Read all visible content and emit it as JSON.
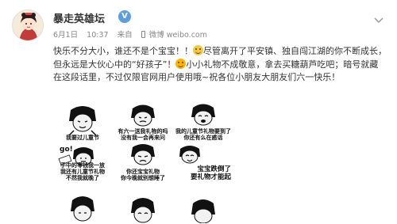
{
  "user": {
    "name": "暴走英雄坛",
    "verified_badge": "V"
  },
  "meta": {
    "date": "6月1日",
    "time": "10:37",
    "source_prefix": "来自",
    "source": "微博 weibo.com"
  },
  "post": {
    "segments": [
      "快乐不分大小，谁还不是个宝宝！！",
      "尽管离开了平安镇、独自闯江湖的你不断成长，但永远是大伙心中的“好孩子”！",
      "小小礼物不成敬意，拿去买糖葫芦吃吧；暗号就藏在这段话里，不过仅限官网用户使用哦~祝各位小朋友大朋友们六一快乐！"
    ]
  },
  "images": [
    {
      "caption": "我要过儿童节"
    },
    {
      "caption": "有六一送我礼物的吗\n没有我一会再来问"
    },
    {
      "caption": "我的儿童节礼物要到了\n你还有么在惑话"
    },
    {
      "caption": "手中的零钱我一放\n我还有儿童节礼物\n不然我就晚了",
      "badge": "go!"
    },
    {
      "caption": "你还宝宝礼物\n你今晚就别想睡了"
    },
    {
      "caption": "宝宝跌倒了\n要礼物才能起"
    },
    {
      "caption": ""
    },
    {
      "caption": ""
    },
    {
      "caption": ""
    }
  ],
  "colors": {
    "verified": "#5b9ee0",
    "text": "#333333",
    "meta": "#888888"
  },
  "icons": {
    "verified": "verified-icon",
    "menu": "chevron-down-icon",
    "device": "phone-icon"
  }
}
